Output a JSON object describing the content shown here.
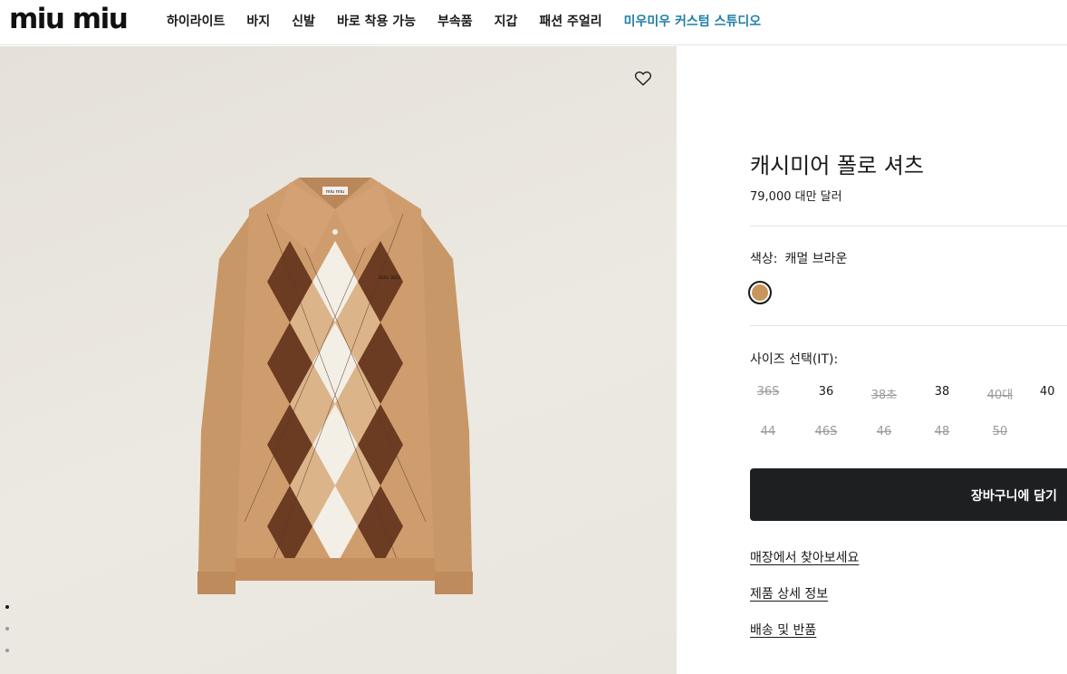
{
  "header": {
    "logo_text": "miu miu",
    "nav": [
      {
        "label": "하이라이트"
      },
      {
        "label": "바지"
      },
      {
        "label": "신발"
      },
      {
        "label": "바로 착용 가능"
      },
      {
        "label": "부속품"
      },
      {
        "label": "지갑"
      },
      {
        "label": "패션 주얼리"
      },
      {
        "label": "미우미우 커스텀 스튜디오"
      }
    ],
    "accent_color": "#1f7fa6"
  },
  "gallery": {
    "wishlist_icon": "heart-outline-icon",
    "dots_total": 3,
    "active_dot": 1
  },
  "product": {
    "title": "캐시미어 폴로 셔츠",
    "price": "79,000 대만 달러",
    "color_label": "색상:",
    "color_value": "캐멀 브라운",
    "swatch_color": "#c8955d",
    "size_label": "사이즈 선택(IT):",
    "sizes": [
      {
        "label": "36S",
        "available": false
      },
      {
        "label": "36",
        "available": true
      },
      {
        "label": "38초",
        "available": false
      },
      {
        "label": "38",
        "available": true
      },
      {
        "label": "40대",
        "available": false
      },
      {
        "label": "40",
        "available": true
      },
      {
        "label": "44",
        "available": false
      },
      {
        "label": "46S",
        "available": false
      },
      {
        "label": "46",
        "available": false
      },
      {
        "label": "48",
        "available": false
      },
      {
        "label": "50",
        "available": false
      }
    ],
    "cart_button": "장바구니에 담기",
    "links": [
      "매장에서 찾아보세요",
      "제품 상세 정보",
      "배송 및 반품"
    ]
  }
}
